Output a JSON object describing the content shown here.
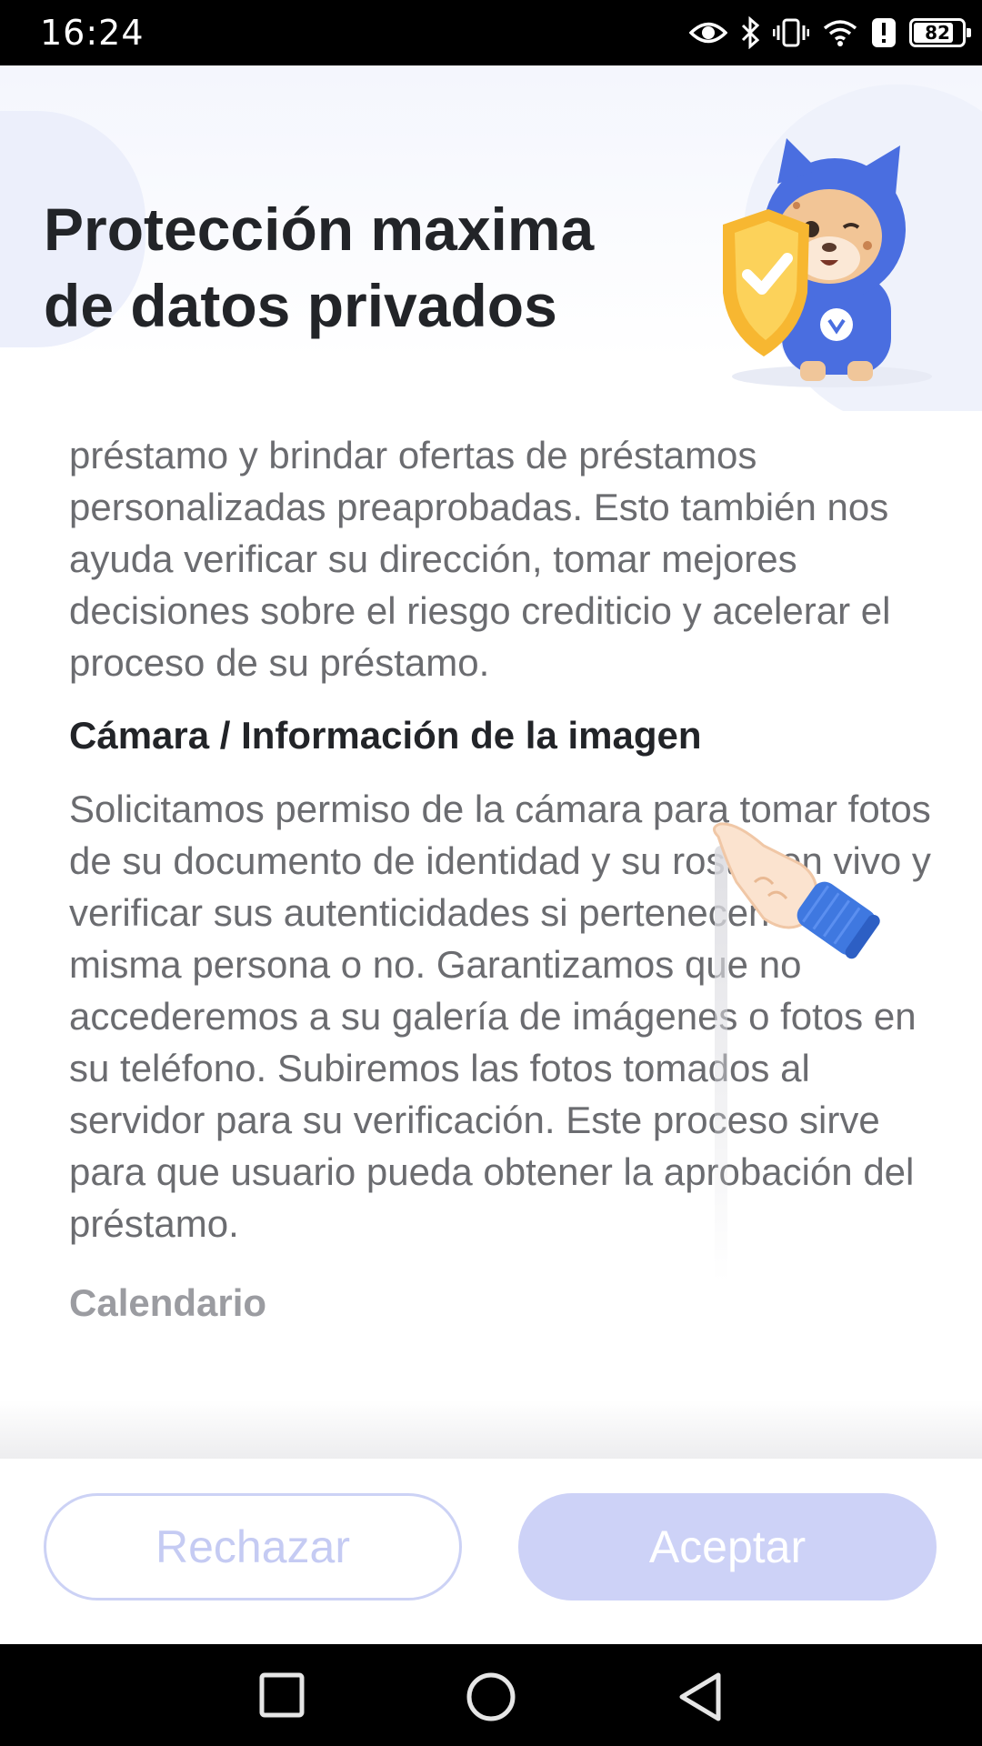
{
  "status_bar": {
    "time": "16:24",
    "battery": "82",
    "battery_level": 0.82,
    "icons": [
      "eye-icon",
      "bluetooth-icon",
      "vibrate-icon",
      "wifi-icon",
      "alert-icon",
      "battery-icon"
    ]
  },
  "header": {
    "title": "Protección maxima de datos privados",
    "illustration": "mascot-with-shield"
  },
  "content": {
    "paragraph_1": "préstamo y brindar ofertas de préstamos personalizadas preaprobadas. Esto también nos ayuda verificar su dirección, tomar mejores decisiones sobre el riesgo crediticio y acelerar el proceso de su préstamo.",
    "camera_heading": "Cámara / Información de la imagen",
    "camera_text": "Solicitamos permiso de la cámara para tomar fotos de su documento de identidad y su rostro en vivo y verificar sus autenticidades si pertenecen a la misma persona o no. Garantizamos que no accederemos a su galería de imágenes o fotos en su teléfono. Subiremos las fotos tomados al servidor para su verificación. Este proceso sirve para que usuario pueda obtener la aprobación del préstamo.",
    "calendar_heading": "Calendario"
  },
  "buttons": {
    "reject": "Rechazar",
    "accept": "Aceptar"
  },
  "colors": {
    "accent": "#cdd2f7",
    "title": "#222428",
    "body_text": "#6b6c70",
    "mascot_blue": "#4a6ee0",
    "shield_gold": "#f7b731"
  },
  "nav_bar": {
    "buttons": [
      "recents-square-icon",
      "home-circle-icon",
      "back-triangle-icon"
    ]
  }
}
